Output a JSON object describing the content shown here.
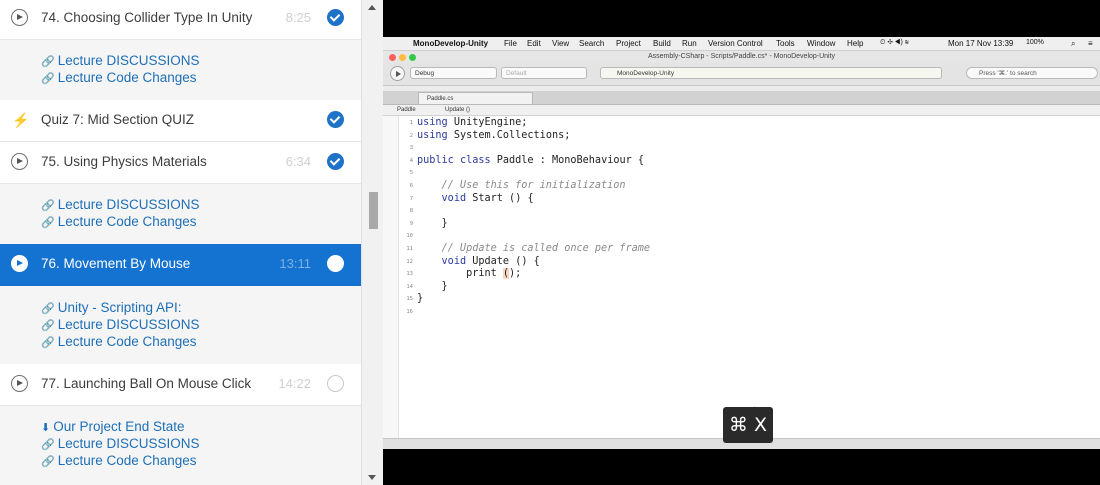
{
  "curriculum": {
    "lectures": [
      {
        "title": "74.  Choosing Collider Type In Unity",
        "duration": "8:25",
        "status": "complete",
        "icon": "play-circle-icon"
      },
      {
        "title": "Quiz 7:  Mid Section QUIZ",
        "duration": "",
        "status": "complete",
        "icon": "bolt-icon"
      },
      {
        "title": "75.  Using Physics Materials",
        "duration": "6:34",
        "status": "complete",
        "icon": "play-circle-icon"
      },
      {
        "title": "76.  Movement By Mouse",
        "duration": "13:11",
        "status": "current",
        "icon": "play-circle-icon"
      },
      {
        "title": "77.  Launching Ball On Mouse Click",
        "duration": "14:22",
        "status": "incomplete",
        "icon": "play-circle-icon"
      }
    ],
    "resources_74": [
      "Lecture DISCUSSIONS",
      "Lecture Code Changes"
    ],
    "resources_75": [
      "Lecture DISCUSSIONS",
      "Lecture Code Changes"
    ],
    "resources_76": [
      "Unity - Scripting API:",
      "Lecture DISCUSSIONS",
      "Lecture Code Changes"
    ],
    "resources_77": [
      "Our Project End State",
      "Lecture DISCUSSIONS",
      "Lecture Code Changes"
    ],
    "accent_color": "#1473d0",
    "link_color": "#1e6fb8"
  },
  "video": {
    "menubar": {
      "apple": "",
      "app": "MonoDevelop-Unity",
      "menus": [
        "File",
        "Edit",
        "View",
        "Search",
        "Project",
        "Build",
        "Run",
        "Version Control",
        "Tools",
        "Window",
        "Help"
      ],
      "clock": "Mon 17 Nov  13:39",
      "battery": "100%"
    },
    "window_title": "Assembly-CSharp - Scripts/Paddle.cs* - MonoDevelop-Unity",
    "toolbar": {
      "config": "Debug",
      "platform": "Default",
      "status": "MonoDevelop-Unity",
      "search_placeholder": "Press '⌘.' to search"
    },
    "tab": "Paddle.cs",
    "path": {
      "class": "Paddle",
      "method": "Update ()"
    },
    "code_lines": [
      "using UnityEngine;",
      "using System.Collections;",
      "",
      "public class Paddle : MonoBehaviour {",
      "",
      "    // Use this for initialization",
      "    void Start () {",
      "",
      "    }",
      "",
      "    // Update is called once per frame",
      "    void Update () {",
      "        print ();",
      "    }",
      "}",
      ""
    ],
    "shortcut_overlay": "⌘ X"
  }
}
